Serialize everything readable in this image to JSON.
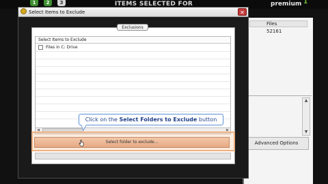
{
  "background_app": {
    "steps": [
      "1",
      "2",
      "3"
    ],
    "title": "ITEMS SELECTED FOR BACKUP",
    "brand": "premium",
    "brand_mark": "1",
    "files_column_header": "Files",
    "files_count": "52161",
    "advanced_options_label": "Advanced Options"
  },
  "dialog": {
    "title": "Select Items to Exclude",
    "close_glyph": "✕",
    "tab_label": "Exclusions",
    "list": {
      "column_header": "Select Items to Exclude",
      "rows": [
        {
          "label": "Files in C: Drive",
          "checked": false
        }
      ]
    },
    "callout": {
      "prefix": "Click on the ",
      "emphasis": "Select Folders to Exclude",
      "suffix": " button"
    },
    "exclude_button_label": "Select folder to exclude..."
  },
  "colors": {
    "accent_button": "#e6a884",
    "highlight_border": "#f0b080",
    "callout_text": "#23458f",
    "close_button": "#c53a3a"
  },
  "icons": [
    "dialog-app-icon",
    "close-icon",
    "checkbox-icon",
    "mouse-cursor-icon",
    "scroll-left-arrow-icon",
    "scroll-right-arrow-icon",
    "scroll-up-arrow-icon",
    "scroll-down-arrow-icon"
  ]
}
